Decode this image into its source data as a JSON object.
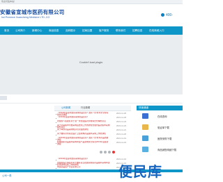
{
  "topbar": {
    "text": "欢迎光临本站！"
  },
  "header": {
    "company_name": "安徽省宣城市医药有限公司",
    "company_name_en": "hui Province Xuancheng Medicine LTD.,CO",
    "phone": "400-"
  },
  "nav": {
    "items": [
      {
        "label": "首页"
      },
      {
        "label": "公司简介"
      },
      {
        "label": "新闻中心"
      },
      {
        "label": "商品信息"
      },
      {
        "label": "品种展示"
      },
      {
        "label": "招商加盟"
      },
      {
        "label": "客户服务"
      },
      {
        "label": "联系我们"
      },
      {
        "label": "招聘信息"
      },
      {
        "label": "在线商城入口"
      }
    ]
  },
  "banner": {
    "message": "Couldn't load plugin."
  },
  "tabs": [
    {
      "label": "公司新闻",
      "active": true
    },
    {
      "label": "行业新闻",
      "active": false
    }
  ],
  "news": [
    {
      "title": "《2019年度后补国家采购药品目录》国家飞行检查安全阶段性情况通报",
      "date": "2021-11-26"
    },
    {
      "title": "《2019年度后补国家采购药品目录》",
      "date": "2021-11-26"
    },
    {
      "title": "安徽省人民政府关于进一步加强医药价格综合管理的意见",
      "date": "2021-11-24"
    },
    {
      "title": "关于药品集中带量采购后监测工作的通知安徽省医药集中采购服务中心",
      "date": "2021-11-22"
    },
    {
      "title": "关于举办药品采购知识培训班的通知",
      "date": "2021-11-21"
    },
    {
      "title": "关于做好全省基层医疗卫生机构药品集中采购工作的通知",
      "date": "2021-11-20"
    },
    {
      "title": "《2019年度后补国家采购药品目录》国家飞行检查药品质量通报",
      "date": "2021-11-19"
    },
    {
      "title": "各地国家药品集中采购中选产品落地执行情况2019年度最新通报",
      "date": "2021-11-18"
    },
    {
      "title": "《2019年度后补国家采购药品目录》",
      "date": "2021-11-16"
    },
    {
      "title": "安徽省医疗保障局关于做好第五批国家组织药品集中采购中选结果落地实施工作的通知",
      "date": "2021-11-15"
    },
    {
      "title": "中选药品生产企业名单公示",
      "date": "2021-11-14"
    }
  ],
  "right_panel": {
    "title": "快速通道",
    "items": [
      {
        "label": "在线咨询",
        "color": "#3b6fd1"
      },
      {
        "label": "验证单下载",
        "color": "#e8b64a"
      },
      {
        "label": "医院采购下载",
        "color": "#4aa0d8"
      },
      {
        "label": "商品销售明细下载",
        "color": "#5ab0e0"
      }
    ]
  },
  "bottom": {
    "title": "公司一角",
    "watermark": "便民库"
  },
  "colors": {
    "nav": "#0e96c9",
    "accent": "#1a4fa3",
    "news": "#c62828"
  }
}
